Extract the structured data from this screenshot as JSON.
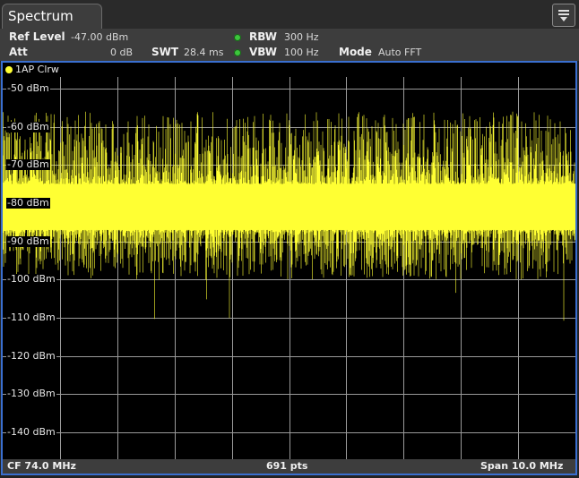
{
  "tab": {
    "title": "Spectrum"
  },
  "menu": {
    "icon": "menu-dropdown-icon"
  },
  "settings": {
    "ref_level_label": "Ref Level",
    "ref_level_value": "-47.00 dBm",
    "att_label": "Att",
    "att_value": "0 dB",
    "swt_label": "SWT",
    "swt_value": "28.4 ms",
    "rbw_label": "RBW",
    "rbw_value": "300 Hz",
    "vbw_label": "VBW",
    "vbw_value": "100 Hz",
    "mode_label": "Mode",
    "mode_value": "Auto FFT"
  },
  "trace": {
    "label": "1AP Clrw",
    "color": "#ffff33"
  },
  "colors": {
    "accent": "#3a6fd0",
    "trace": "#ffff33",
    "status_ok": "#3cc63c",
    "grid": "#9a9a9a"
  },
  "chart_data": {
    "type": "line",
    "title": "",
    "ytick_labels": [
      "-50 dBm",
      "-60 dBm",
      "-70 dBm",
      "-80 dBm",
      "-90 dBm",
      "-100 dBm",
      "-110 dBm",
      "-120 dBm",
      "-130 dBm",
      "-140 dBm"
    ],
    "ytick_values": [
      -50,
      -60,
      -70,
      -80,
      -90,
      -100,
      -110,
      -120,
      -130,
      -140
    ],
    "ylim": [
      -147,
      -47
    ],
    "grid": true,
    "grid_divisions_x": 10,
    "series": [
      {
        "noise_band_top_dBm": -75,
        "noise_band_bottom_dBm": -87,
        "peak_max_dBm": -56,
        "dip_min_dBm": -112
      }
    ]
  },
  "footer": {
    "cf": "CF 74.0 MHz",
    "points": "691 pts",
    "span": "Span 10.0 MHz"
  }
}
